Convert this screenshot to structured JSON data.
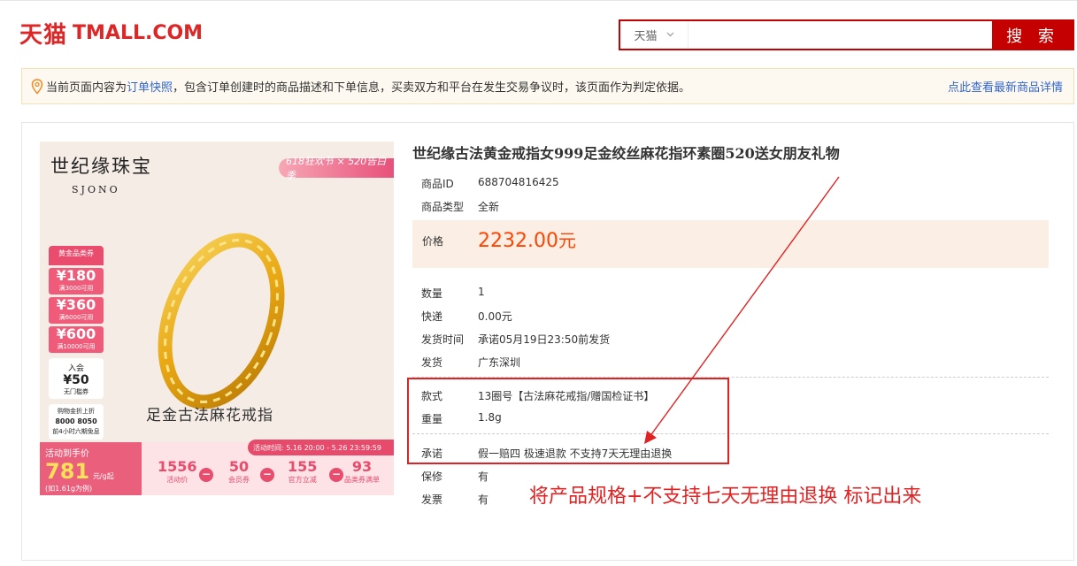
{
  "header": {
    "logo_cn": "天猫",
    "logo_en": "TMALL.COM",
    "search_scope": "天猫",
    "search_placeholder": "",
    "search_button": "搜 索"
  },
  "notice": {
    "text_before": "当前页面内容为",
    "link_text": "订单快照",
    "text_after": "，包含订单创建时的商品描述和下单信息，买卖双方和平台在发生交易争议时，该页面作为判定依据。",
    "right_link": "点此查看最新商品详情"
  },
  "product_image": {
    "brand_cn": "世纪缘珠宝",
    "brand_en": "SJONO",
    "promo_tag": "618狂欢节 × 520告白季",
    "coupon_head": "黄金品类券",
    "coupons": [
      {
        "value": "¥180",
        "desc": "满3000可用"
      },
      {
        "value": "¥360",
        "desc": "满6000可用"
      },
      {
        "value": "¥600",
        "desc": "满10000可用"
      }
    ],
    "join_t1": "入会",
    "join_t2": "¥50",
    "join_t3": "无门槛券",
    "gold_text_1": "购物金折上折",
    "gold_text_2": "8000  8050",
    "gold_text_3": "前4小时六期免息",
    "ring_name": "足金古法麻花戒指",
    "time_bar": "活动时间: 5.16 20:00 - 5.26 23:59:59",
    "price_label": "活动到手价",
    "price_value": "781",
    "price_unit": "元/g起",
    "price_sub": "(如1.61g为例)",
    "calc": [
      {
        "n": "1556",
        "l": "活动价"
      },
      {
        "n": "50",
        "l": "会员券"
      },
      {
        "n": "155",
        "l": "官方立减"
      },
      {
        "n": "93",
        "l": "品类券满单"
      }
    ]
  },
  "product": {
    "title": "世纪缘古法黄金戒指女999足金绞丝麻花指环素圈520送女朋友礼物",
    "id_label": "商品ID",
    "id_value": "688704816425",
    "type_label": "商品类型",
    "type_value": "全新",
    "price_label": "价格",
    "price_value": "2232.00",
    "price_unit": "元",
    "qty_label": "数量",
    "qty_value": "1",
    "ship_label": "快递",
    "ship_value": "0.00元",
    "time_label": "发货时间",
    "time_value": "承诺05月19日23:50前发货",
    "from_label": "发货",
    "from_value": "广东深圳",
    "style_label": "款式",
    "style_value": "13圈号【古法麻花戒指/赠国检证书】",
    "weight_label": "重量",
    "weight_value": "1.8g",
    "promise_label": "承诺",
    "promise_value": "假一赔四 极速退款 不支持7天无理由退换",
    "warranty_label": "保修",
    "warranty_value": "有",
    "invoice_label": "发票",
    "invoice_value": "有"
  },
  "annotation": {
    "text": "将产品规格+不支持七天无理由退换 标记出来",
    "color": "#e02222"
  }
}
